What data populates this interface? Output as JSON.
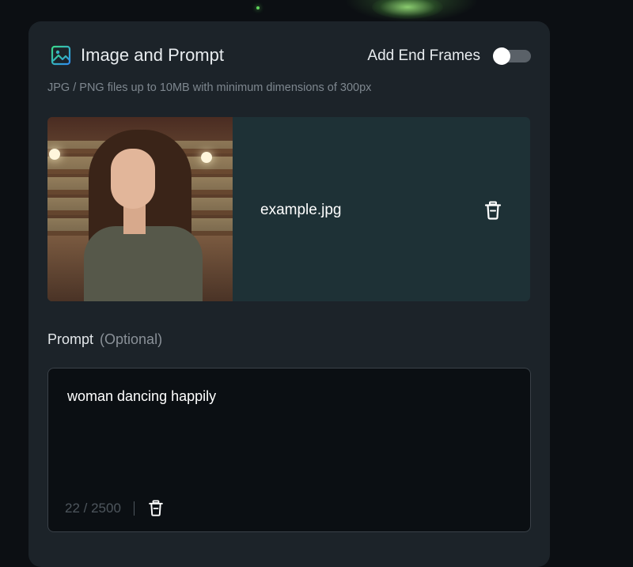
{
  "panel": {
    "title": "Image and Prompt",
    "icon": "image-icon",
    "end_frames_label": "Add End Frames",
    "end_frames_enabled": false,
    "file_note": "JPG / PNG files up to 10MB with minimum dimensions of 300px"
  },
  "file": {
    "name": "example.jpg",
    "delete_icon": "trash-icon"
  },
  "prompt": {
    "label": "Prompt",
    "optional_label": "(Optional)",
    "value": "woman dancing happily",
    "char_count": "22 / 2500",
    "clear_icon": "trash-icon"
  },
  "colors": {
    "accent_icon_start": "#3bd88a",
    "accent_icon_end": "#2f8df0",
    "panel_bg": "#1c2329",
    "file_card_bg": "#1e3136"
  }
}
